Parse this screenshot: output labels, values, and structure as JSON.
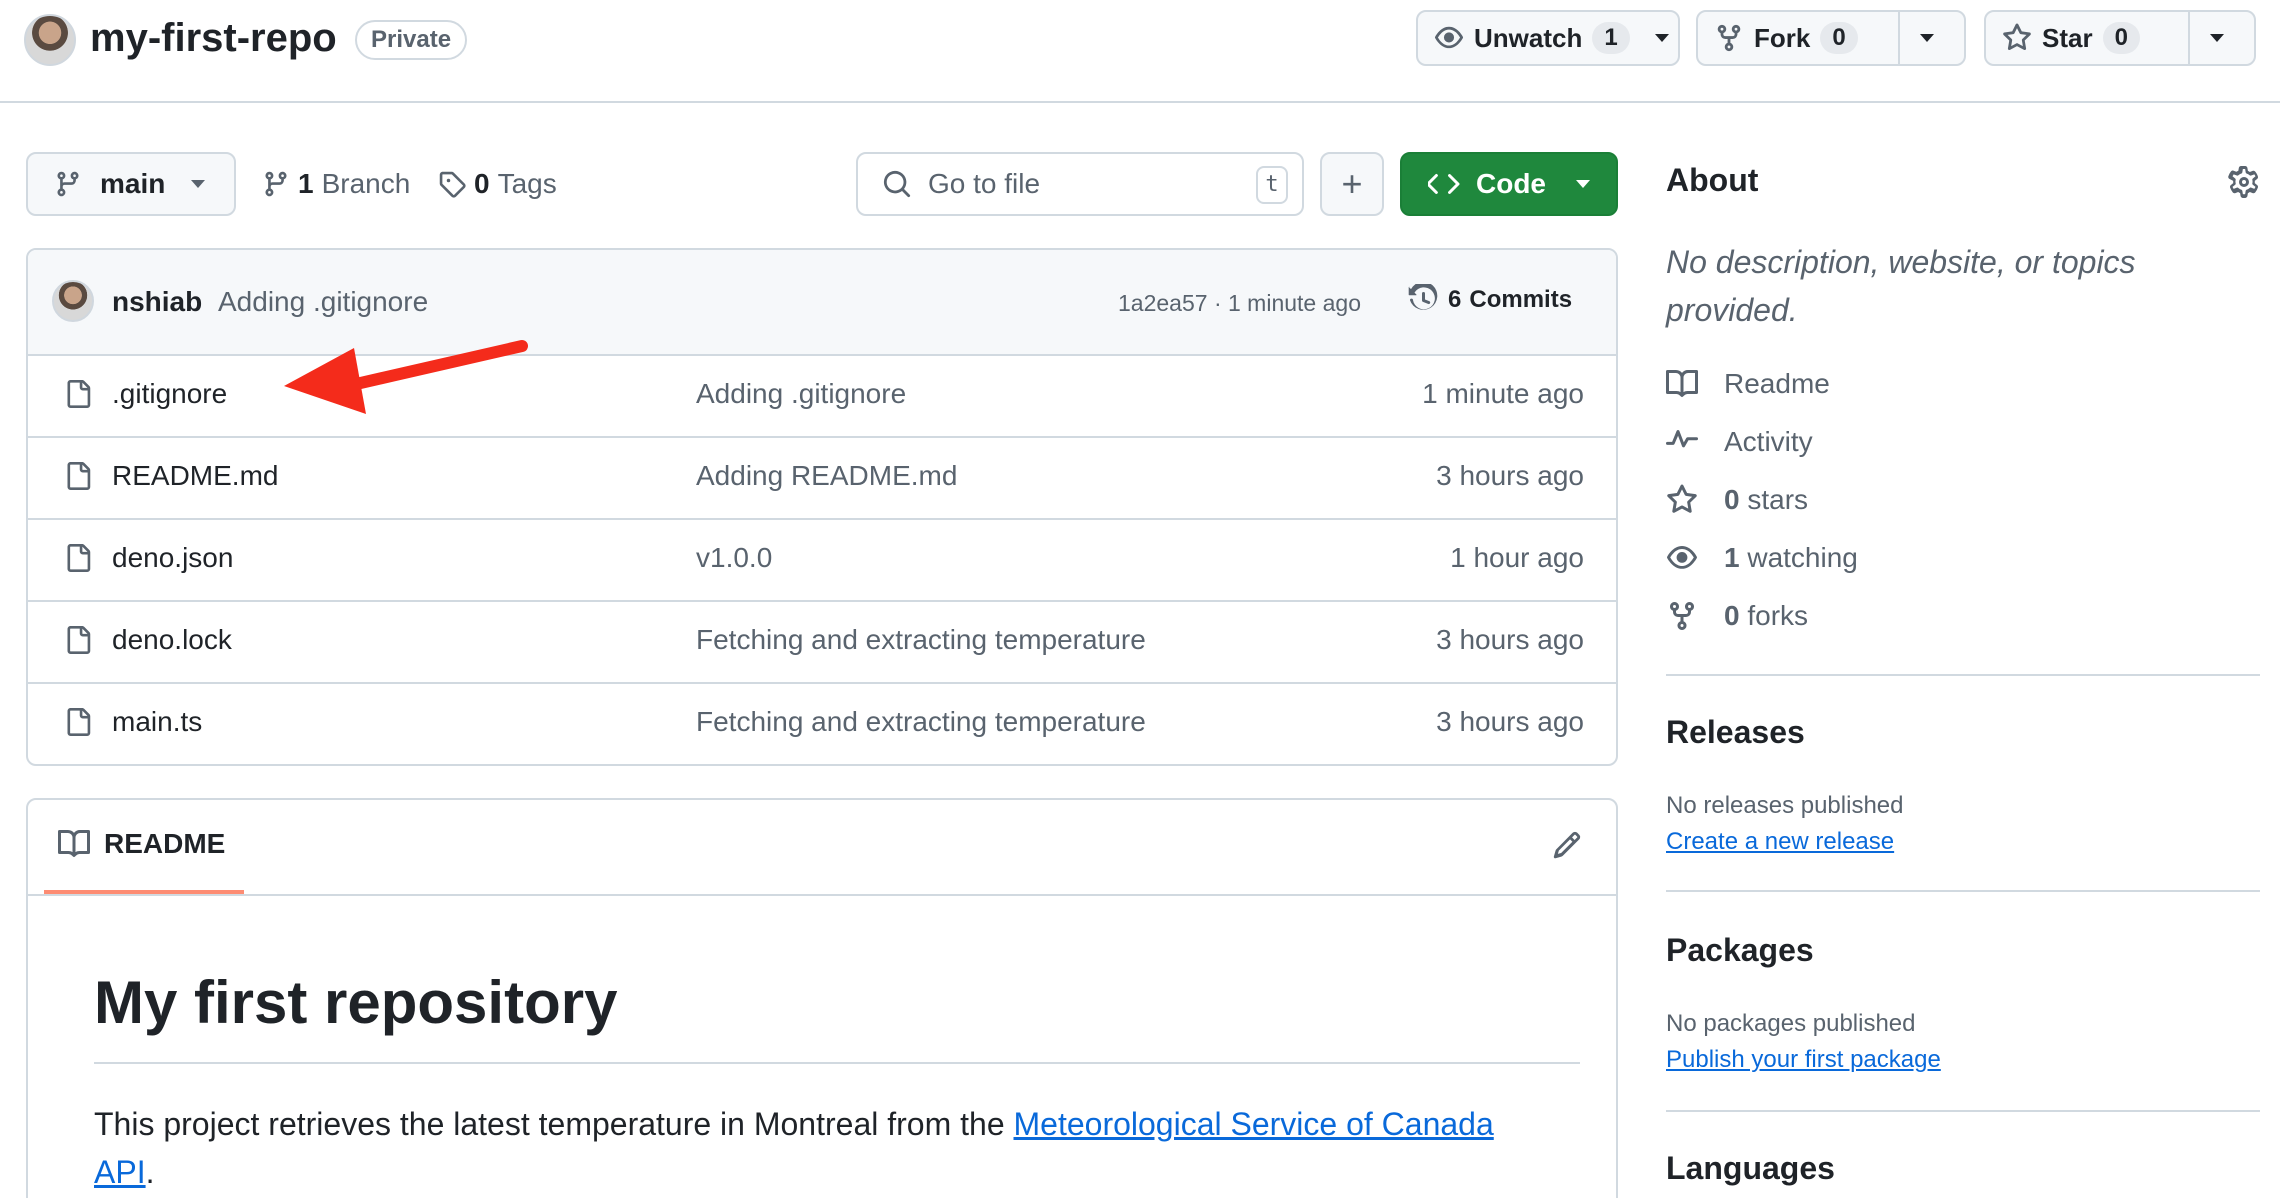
{
  "repo": {
    "name": "my-first-repo",
    "visibility": "Private"
  },
  "actions": {
    "watch_label": "Unwatch",
    "watch_count": "1",
    "fork_label": "Fork",
    "fork_count": "0",
    "star_label": "Star",
    "star_count": "0"
  },
  "toolbar": {
    "branch": "main",
    "branch_count": "1",
    "branch_label": "Branch",
    "tag_count": "0",
    "tag_label": "Tags",
    "search_placeholder": "Go to file",
    "search_shortcut": "t",
    "add_label": "+",
    "code_label": "Code"
  },
  "latest_commit": {
    "author": "nshiab",
    "message": "Adding .gitignore",
    "hash": "1a2ea57",
    "time": "1 minute ago",
    "separator": "·",
    "commits_count": "6",
    "commits_label": "Commits"
  },
  "files": [
    {
      "name": ".gitignore",
      "message": "Adding .gitignore",
      "time": "1 minute ago"
    },
    {
      "name": "README.md",
      "message": "Adding README.md",
      "time": "3 hours ago"
    },
    {
      "name": "deno.json",
      "message": "v1.0.0",
      "time": "1 hour ago"
    },
    {
      "name": "deno.lock",
      "message": "Fetching and extracting temperature",
      "time": "3 hours ago"
    },
    {
      "name": "main.ts",
      "message": "Fetching and extracting temperature",
      "time": "3 hours ago"
    }
  ],
  "readme": {
    "tab_label": "README",
    "heading": "My first repository",
    "text_before": "This project retrieves the latest temperature in Montreal from the ",
    "link_text_1": "Meteorological Service of Canada",
    "link_text_2": "API",
    "text_after": "."
  },
  "about": {
    "title": "About",
    "description": "No description, website, or topics provided.",
    "readme_label": "Readme",
    "activity_label": "Activity",
    "stars_count": "0",
    "stars_label": "stars",
    "watching_count": "1",
    "watching_label": "watching",
    "forks_count": "0",
    "forks_label": "forks"
  },
  "releases": {
    "title": "Releases",
    "empty_text": "No releases published",
    "create_link": "Create a new release"
  },
  "packages": {
    "title": "Packages",
    "empty_text": "No packages published",
    "publish_link": "Publish your first package"
  },
  "languages": {
    "title": "Languages"
  },
  "colors": {
    "code_button": "#1f883d",
    "link": "#0969da",
    "annotation_arrow": "#f42b1b",
    "readme_tab_underline": "#fd8c73"
  },
  "annotation": {
    "type": "arrow",
    "target": ".gitignore"
  }
}
